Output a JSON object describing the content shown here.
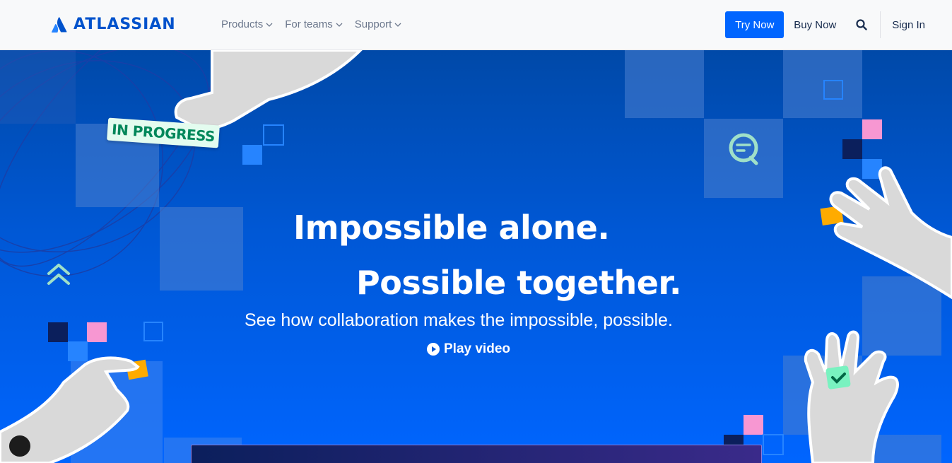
{
  "brand": {
    "name": "ATLASSIAN",
    "color": "#0052cc"
  },
  "nav": {
    "items": [
      {
        "label": "Products"
      },
      {
        "label": "For teams"
      },
      {
        "label": "Support"
      }
    ]
  },
  "actions": {
    "try_now": "Try Now",
    "buy_now": "Buy Now",
    "sign_in": "Sign In"
  },
  "hero": {
    "headline_line1": "Impossible alone.",
    "headline_line2": "Possible together.",
    "subtitle": "See how collaboration makes the impossible, possible.",
    "play_label": "Play video",
    "sticker": "IN PROGRESS"
  },
  "colors": {
    "accent": "#0065ff",
    "hero_top": "#0049a8",
    "hero_bottom": "#0065ff",
    "sticker_bg": "#e3fcef",
    "sticker_text": "#00875a",
    "pink": "#f797d2",
    "yellow": "#ffab00",
    "teal": "#79e2f2"
  }
}
